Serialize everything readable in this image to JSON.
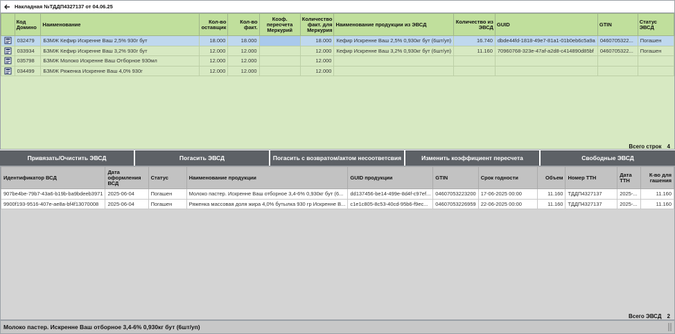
{
  "window": {
    "title": "Накладная №ТДДП4327137 от 04.06.25"
  },
  "top_table": {
    "headers": [
      "Код Домино",
      "Наименование",
      "Кол-во оставщик",
      "Кол-во факт.",
      "Коэф. пересчета Меркурий",
      "Количество факт. для Меркурия",
      "Наименование продукции из ЭВСД",
      "Количество из ЭВСД",
      "GUID",
      "GTIN",
      "Статус ЭВСД"
    ],
    "rows": [
      {
        "code": "032479",
        "name": "БЗМЖ Кефир Искренне Ваш 2,5% 930г бут",
        "qty_supplier": "18.000",
        "qty_fact": "18.000",
        "coef": "",
        "qty_merc": "18.000",
        "evsd_name": "Кефир Искренне Ваш 2,5% 0,930кг бут (6шт/уп)",
        "evsd_qty": "16.740",
        "guid": "dbde44fd-1818-49e7-81a1-01b0eb6c5a9a",
        "gtin": "0460705322...",
        "status": "Погашен"
      },
      {
        "code": "033934",
        "name": "БЗМЖ Кефир Искренне Ваш 3,2% 930г бут",
        "qty_supplier": "12.000",
        "qty_fact": "12.000",
        "coef": "",
        "qty_merc": "12.000",
        "evsd_name": "Кефир Искренне Ваш 3,2% 0,930кг бут (6шт/уп)",
        "evsd_qty": "11.160",
        "guid": "70960768-323e-47af-a2d8-c414890d85bf",
        "gtin": "0460705322...",
        "status": "Погашен"
      },
      {
        "code": "035798",
        "name": "БЗМЖ Молоко Искренне Ваш Отборное 930мл",
        "qty_supplier": "12.000",
        "qty_fact": "12.000",
        "coef": "",
        "qty_merc": "12.000",
        "evsd_name": "",
        "evsd_qty": "",
        "guid": "",
        "gtin": "",
        "status": ""
      },
      {
        "code": "034499",
        "name": "БЗМЖ Ряженка Искренне Ваш 4,0% 930г",
        "qty_supplier": "12.000",
        "qty_fact": "12.000",
        "coef": "",
        "qty_merc": "12.000",
        "evsd_name": "",
        "evsd_qty": "",
        "guid": "",
        "gtin": "",
        "status": ""
      }
    ],
    "total_label": "Всего строк",
    "total_value": "4"
  },
  "buttons": {
    "bind": "Привязать/Очистить ЭВСД",
    "redeem": "Погасить ЭВСД",
    "redeem_return": "Погасить с возвратом/актом несоответсвия",
    "change_coef": "Изменить коэффициент пересчета",
    "free": "Свободные ЭВСД"
  },
  "bottom_table": {
    "headers": [
      "Идентификатор ВСД",
      "Дата оформления ВСД",
      "Статус",
      "Наименование продукции",
      "GUID продукции",
      "GTIN",
      "Срок годности",
      "Объем",
      "Номер ТТН",
      "Дата ТТН",
      "К-во для гашения"
    ],
    "rows": [
      {
        "id": "907be4be-79b7-43a6-b19b-ba9bdeeb3971",
        "date": "2025-06-04",
        "status": "Погашен",
        "name": "Молоко пастер. Искренне Ваш отборное 3,4-6% 0,930кг бут (6...",
        "guid": "dd137456-be14-499e-8d4f-c97ef...",
        "gtin": "04607053223200",
        "expiry": "17-06-2025 00:00",
        "volume": "11.160",
        "ttn": "ТДДП4327137",
        "ttn_date": "2025-...",
        "qty": "11.160"
      },
      {
        "id": "9900f193-9516-407e-ae8a-bf4f13070008",
        "date": "2025-06-04",
        "status": "Погашен",
        "name": "Ряженка массовая доля жира 4,0% бутылка 930 гр Искренне В...",
        "guid": "c1e1c805-8c53-40cd-95b6-f9ec...",
        "gtin": "04607053226959",
        "expiry": "22-06-2025 00:00",
        "volume": "11.160",
        "ttn": "ТДДП4327137",
        "ttn_date": "2025-...",
        "qty": "11.160"
      }
    ],
    "total_label": "Всего ЭВСД",
    "total_value": "2"
  },
  "status_bar": {
    "text": "Молоко пастер. Искренне Ваш отборное 3,4-6% 0,930кг бут (6шт/уп)"
  },
  "colors": {
    "top_bg": "#d7e9c2",
    "top_header": "#c0df9c",
    "selected_row": "#bfd8ee",
    "button_bg": "#5d6166",
    "bottom_bg": "#d4d4d4"
  }
}
